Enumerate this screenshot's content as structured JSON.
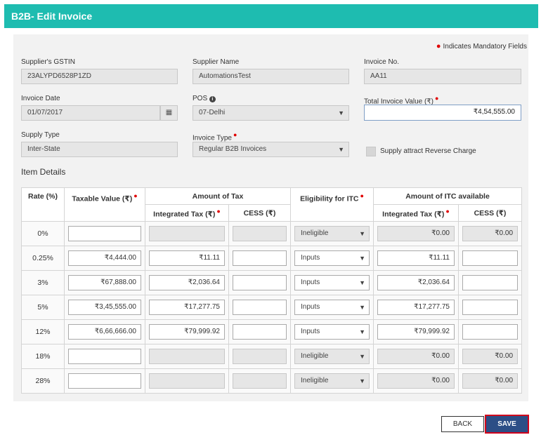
{
  "header": {
    "title": "B2B- Edit Invoice"
  },
  "mandatory_note": "Indicates Mandatory Fields",
  "fields": {
    "supplier_gstin": {
      "label": "Supplier's GSTIN",
      "value": "23ALYPD6528P1ZD"
    },
    "supplier_name": {
      "label": "Supplier Name",
      "value": "AutomationsTest"
    },
    "invoice_no": {
      "label": "Invoice No.",
      "value": "AA11"
    },
    "invoice_date": {
      "label": "Invoice Date",
      "value": "01/07/2017"
    },
    "pos": {
      "label": "POS",
      "value": "07-Delhi"
    },
    "total_invoice_value": {
      "label": "Total Invoice Value (₹)",
      "value": "₹4,54,555.00"
    },
    "supply_type": {
      "label": "Supply Type",
      "value": "Inter-State"
    },
    "invoice_type": {
      "label": "Invoice Type",
      "value": "Regular B2B Invoices"
    },
    "reverse_charge": {
      "label": "Supply attract Reverse Charge"
    }
  },
  "items": {
    "title": "Item Details",
    "headers": {
      "rate": "Rate (%)",
      "taxable_value": "Taxable Value (₹)",
      "amount_of_tax": "Amount of Tax",
      "eligibility": "Eligibility for ITC",
      "itc_available": "Amount of ITC available",
      "integrated_tax": "Integrated Tax (₹)",
      "cess": "CESS (₹)",
      "itc_integrated_tax": "Integrated Tax (₹)",
      "itc_cess": "CESS (₹)"
    },
    "rows": [
      {
        "rate": "0%",
        "taxable": "",
        "igst": "",
        "cess": "",
        "elig": "Ineligible",
        "itc_igst": "₹0.00",
        "itc_cess": "₹0.00"
      },
      {
        "rate": "0.25%",
        "taxable": "₹4,444.00",
        "igst": "₹11.11",
        "cess": "",
        "elig": "Inputs",
        "itc_igst": "₹11.11",
        "itc_cess": ""
      },
      {
        "rate": "3%",
        "taxable": "₹67,888.00",
        "igst": "₹2,036.64",
        "cess": "",
        "elig": "Inputs",
        "itc_igst": "₹2,036.64",
        "itc_cess": ""
      },
      {
        "rate": "5%",
        "taxable": "₹3,45,555.00",
        "igst": "₹17,277.75",
        "cess": "",
        "elig": "Inputs",
        "itc_igst": "₹17,277.75",
        "itc_cess": ""
      },
      {
        "rate": "12%",
        "taxable": "₹6,66,666.00",
        "igst": "₹79,999.92",
        "cess": "",
        "elig": "Inputs",
        "itc_igst": "₹79,999.92",
        "itc_cess": ""
      },
      {
        "rate": "18%",
        "taxable": "",
        "igst": "",
        "cess": "",
        "elig": "Ineligible",
        "itc_igst": "₹0.00",
        "itc_cess": "₹0.00"
      },
      {
        "rate": "28%",
        "taxable": "",
        "igst": "",
        "cess": "",
        "elig": "Ineligible",
        "itc_igst": "₹0.00",
        "itc_cess": "₹0.00"
      }
    ]
  },
  "buttons": {
    "back": "BACK",
    "save": "SAVE"
  },
  "colors": {
    "header_bg": "#1ebcb0",
    "save_bg": "#2c4e86",
    "save_border": "#d0021b",
    "required": "#e00000"
  },
  "icons": {
    "calendar": "calendar-icon",
    "info": "info-icon",
    "dropdown": "chevron-down-icon"
  }
}
